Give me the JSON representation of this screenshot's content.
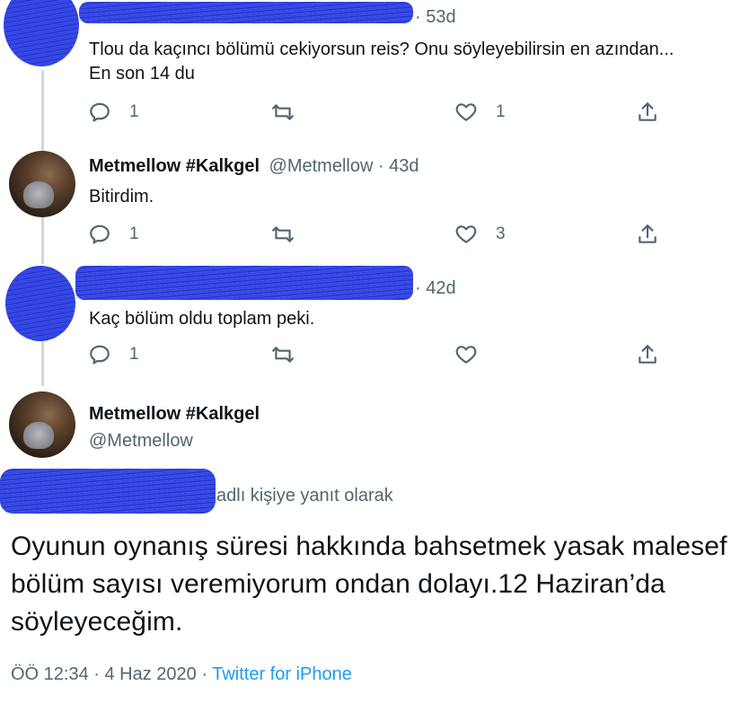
{
  "tweets": [
    {
      "time": "· 53d",
      "text": "Tlou da kaçıncı bölümü cekiyorsun reis? Onu söyleyebilirsin en azından...\nEn son 14 du",
      "replies": "1",
      "likes": "1"
    },
    {
      "name": "Metmellow #Kalkgel",
      "handle": "@Metmellow · 43d",
      "text": "Bitirdim.",
      "replies": "1",
      "likes": "3"
    },
    {
      "time": "· 42d",
      "text": "Kaç bölüm oldu toplam peki.",
      "replies": "1",
      "likes": ""
    }
  ],
  "main_tweet": {
    "name": "Metmellow #Kalkgel",
    "handle": "@Metmellow",
    "reply_to": "adlı kişiye yanıt olarak",
    "text": "Oyunun oynanış süresi hakkında bahsetmek yasak malesef bölüm sayısı veremiyorum ondan dolayı.12 Haziran’da söyleyeceğim.",
    "timestamp": "ÖÖ 12:34 · 4 Haz 2020 · ",
    "source": "Twitter for iPhone"
  },
  "colors": {
    "text": "#0f1419",
    "secondary": "#536471",
    "link": "#1d9bf0",
    "thread_line": "#cfd9de",
    "scribble": "#2a3bd6"
  },
  "icons": [
    "reply-icon",
    "retweet-icon",
    "like-icon",
    "share-icon"
  ]
}
